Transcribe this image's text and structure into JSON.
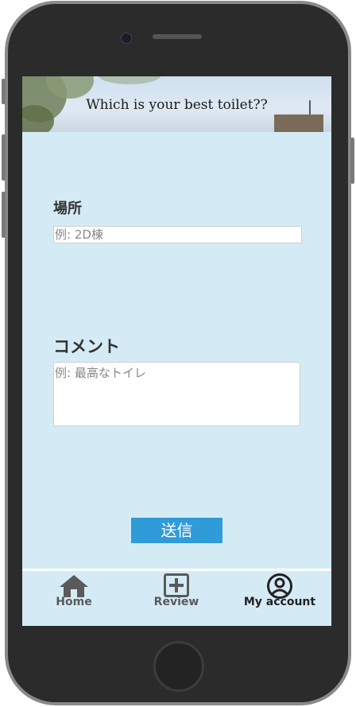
{
  "banner": {
    "title": "Which is your best toilet??"
  },
  "form": {
    "place": {
      "label": "場所",
      "placeholder": "例: 2D棟"
    },
    "comment": {
      "label": "コメント",
      "placeholder": "例:  最高なトイレ"
    },
    "submit_label": "送信"
  },
  "nav": {
    "items": [
      {
        "label": "Home",
        "icon": "home-icon",
        "color": "#5a5a5a"
      },
      {
        "label": "Review",
        "icon": "plus-square-icon",
        "color": "#5a5a5a"
      },
      {
        "label": "My account",
        "icon": "account-icon",
        "color": "#222222"
      }
    ]
  },
  "colors": {
    "screen_background": "#d4ebf6",
    "submit_button": "#2f9bd9",
    "device_frame": "#2b2b2b"
  }
}
